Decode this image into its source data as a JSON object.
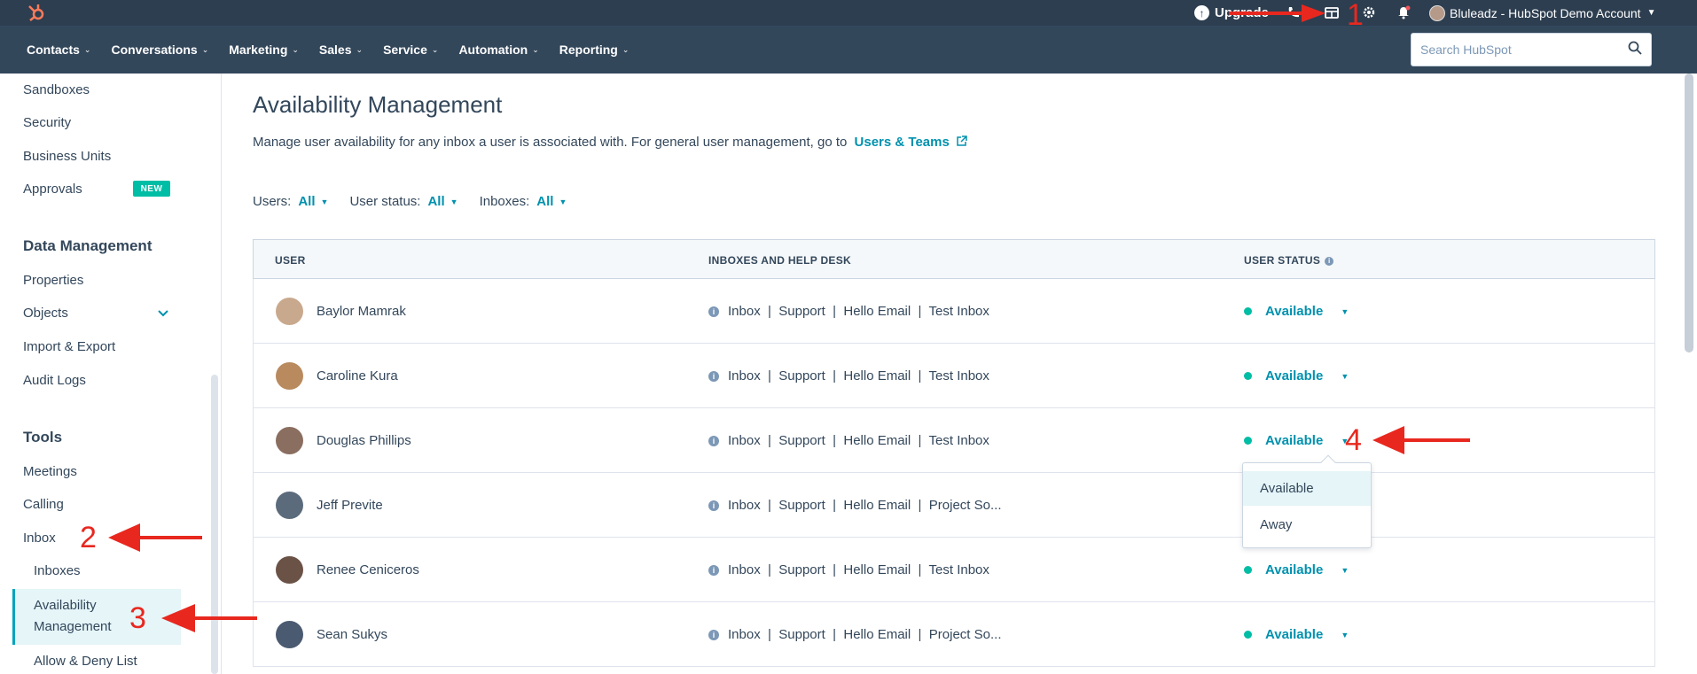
{
  "topbar": {
    "logo_icon": "hubspot-sprocket-icon",
    "upgrade_label": "Upgrade",
    "account_label": "Bluleadz - HubSpot Demo Account",
    "icons": [
      "call-icon",
      "marketplace-icon",
      "settings-gear-icon",
      "notifications-bell-icon"
    ]
  },
  "nav": {
    "items": [
      {
        "label": "Contacts"
      },
      {
        "label": "Conversations"
      },
      {
        "label": "Marketing"
      },
      {
        "label": "Sales"
      },
      {
        "label": "Service"
      },
      {
        "label": "Automation"
      },
      {
        "label": "Reporting"
      }
    ],
    "search_placeholder": "Search HubSpot"
  },
  "sidebar": {
    "links_top": [
      {
        "label": "Sandboxes"
      },
      {
        "label": "Security"
      },
      {
        "label": "Business Units"
      },
      {
        "label": "Approvals"
      }
    ],
    "new_badge": "NEW",
    "data_mgmt_heading": "Data Management",
    "data_mgmt_items": [
      {
        "label": "Properties"
      },
      {
        "label": "Objects"
      },
      {
        "label": "Import & Export"
      },
      {
        "label": "Audit Logs"
      }
    ],
    "tools_heading": "Tools",
    "tools_items": [
      {
        "label": "Meetings"
      },
      {
        "label": "Calling"
      },
      {
        "label": "Inbox"
      }
    ],
    "inbox_sub": [
      {
        "label": "Inboxes"
      },
      {
        "label": "Availability Management"
      },
      {
        "label": "Allow & Deny List"
      }
    ]
  },
  "main": {
    "title": "Availability Management",
    "description": "Manage user availability for any inbox a user is associated with. For general user management, go to",
    "link_label": "Users & Teams",
    "filters": [
      {
        "label": "Users:",
        "value": "All"
      },
      {
        "label": "User status:",
        "value": "All"
      },
      {
        "label": "Inboxes:",
        "value": "All"
      }
    ],
    "columns": [
      "USER",
      "INBOXES AND HELP DESK",
      "USER STATUS"
    ],
    "rows": [
      {
        "name": "Baylor Mamrak",
        "inboxes": "Inbox  |  Support  |  Hello Email  |  Test Inbox",
        "status": "Available",
        "avatar_color": "#c9a98d"
      },
      {
        "name": "Caroline Kura",
        "inboxes": "Inbox  |  Support  |  Hello Email  |  Test Inbox",
        "status": "Available",
        "avatar_color": "#b98a5e"
      },
      {
        "name": "Douglas Phillips",
        "inboxes": "Inbox  |  Support  |  Hello Email  |  Test Inbox",
        "status": "Available",
        "avatar_color": "#8a6e60"
      },
      {
        "name": "Jeff Previte",
        "inboxes": "Inbox  |  Support  |  Hello Email  |  Project So...",
        "status": "",
        "avatar_color": "#5b6b7c"
      },
      {
        "name": "Renee Ceniceros",
        "inboxes": "Inbox  |  Support  |  Hello Email  |  Test Inbox",
        "status": "Available",
        "avatar_color": "#6b5247"
      },
      {
        "name": "Sean Sukys",
        "inboxes": "Inbox  |  Support  |  Hello Email  |  Project So...",
        "status": "Available",
        "avatar_color": "#4a5a70"
      }
    ],
    "dropdown_options": [
      "Available",
      "Away"
    ]
  },
  "annotations": {
    "one": "1",
    "two": "2",
    "three": "3",
    "four": "4"
  },
  "colors": {
    "topbar": "#2d3e50",
    "navbar": "#33475b",
    "accent": "#0091ae",
    "available": "#00bda5",
    "annotation_red": "#e8281f"
  }
}
